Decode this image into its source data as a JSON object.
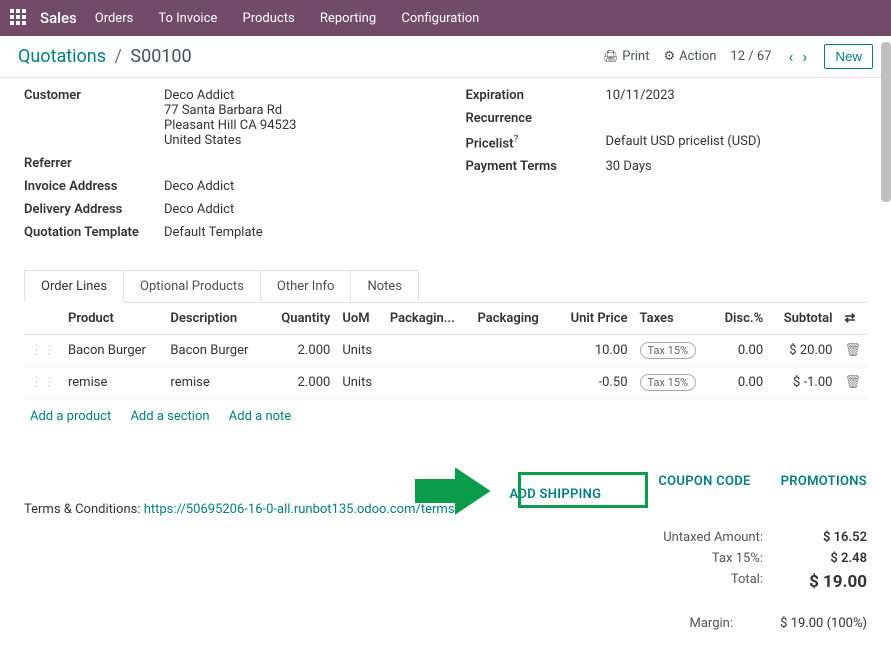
{
  "topbar": {
    "app": "Sales",
    "menu": [
      "Orders",
      "To Invoice",
      "Products",
      "Reporting",
      "Configuration"
    ]
  },
  "subbar": {
    "bc_root": "Quotations",
    "bc_current": "S00100",
    "print": "Print",
    "action": "Action",
    "pager": "12 / 67",
    "newbtn": "New"
  },
  "form": {
    "customer_label": "Customer",
    "customer_name": "Deco Addict",
    "customer_addr1": "77 Santa Barbara Rd",
    "customer_addr2": "Pleasant Hill CA 94523",
    "customer_addr3": "United States",
    "referrer_label": "Referrer",
    "invaddr_label": "Invoice Address",
    "invaddr": "Deco Addict",
    "deladdr_label": "Delivery Address",
    "deladdr": "Deco Addict",
    "qtmpl_label": "Quotation Template",
    "qtmpl": "Default Template",
    "exp_label": "Expiration",
    "exp": "10/11/2023",
    "rec_label": "Recurrence",
    "price_label": "Pricelist",
    "price": "Default USD pricelist (USD)",
    "pay_label": "Payment Terms",
    "pay": "30 Days"
  },
  "tabs": {
    "t0": "Order Lines",
    "t1": "Optional Products",
    "t2": "Other Info",
    "t3": "Notes"
  },
  "cols": {
    "product": "Product",
    "desc": "Description",
    "qty": "Quantity",
    "uom": "UoM",
    "pkg1": "Packagin...",
    "pkg2": "Packaging",
    "unit": "Unit Price",
    "taxes": "Taxes",
    "disc": "Disc.%",
    "sub": "Subtotal"
  },
  "lines": [
    {
      "product": "Bacon Burger",
      "desc": "Bacon Burger",
      "qty": "2.000",
      "uom": "Units",
      "unit": "10.00",
      "tax": "Tax 15%",
      "disc": "0.00",
      "sub": "$ 20.00"
    },
    {
      "product": "remise",
      "desc": "remise",
      "qty": "2.000",
      "uom": "Units",
      "unit": "-0.50",
      "tax": "Tax 15%",
      "disc": "0.00",
      "sub": "$ -1.00"
    }
  ],
  "add": {
    "product": "Add a product",
    "section": "Add a section",
    "note": "Add a note"
  },
  "terms": {
    "label": "Terms & Conditions: ",
    "url": "https://50695206-16-0-all.runbot135.odoo.com/terms"
  },
  "actions": {
    "ship": "ADD SHIPPING",
    "coupon": "COUPON CODE",
    "promo": "PROMOTIONS"
  },
  "totals": {
    "untaxed_l": "Untaxed Amount:",
    "untaxed_v": "$ 16.52",
    "tax_l": "Tax 15%:",
    "tax_v": "$ 2.48",
    "total_l": "Total:",
    "total_v": "$ 19.00",
    "margin_l": "Margin:",
    "margin_v": "$ 19.00 (100%)"
  }
}
